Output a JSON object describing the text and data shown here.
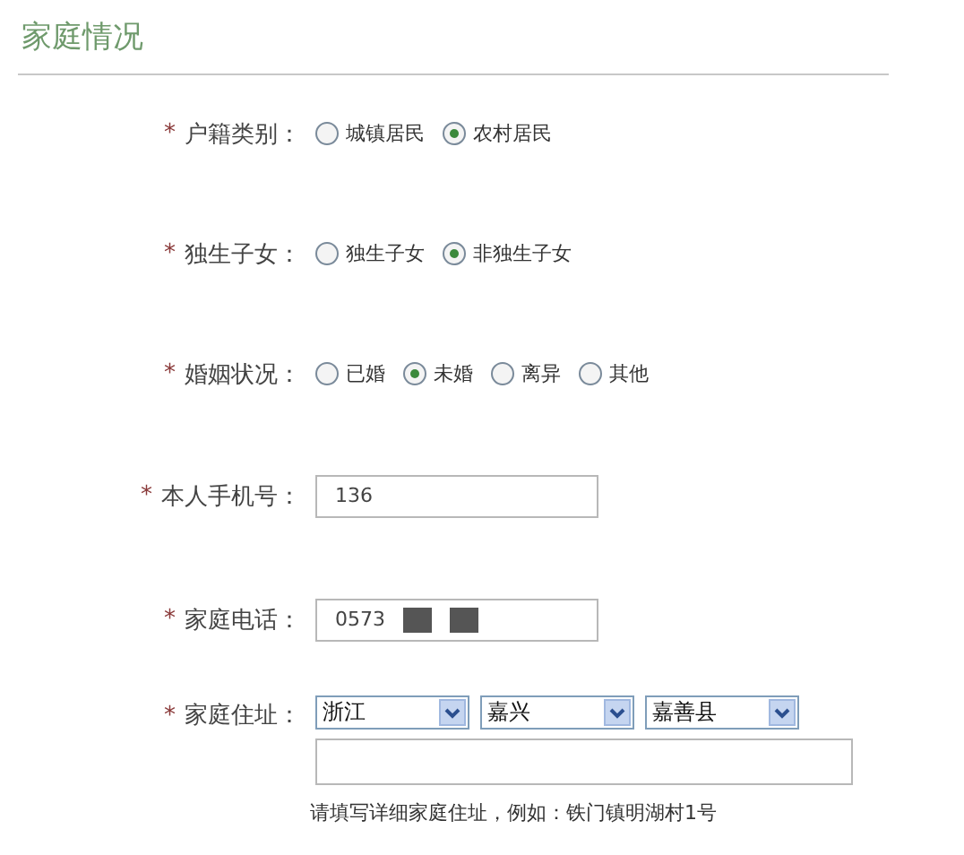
{
  "section": {
    "title": "家庭情况"
  },
  "fields": [
    {
      "kind": "radio",
      "required_mark": "*",
      "label": "户籍类别：",
      "options": [
        {
          "label": "城镇居民",
          "selected": false
        },
        {
          "label": "农村居民",
          "selected": true
        }
      ]
    },
    {
      "kind": "radio",
      "required_mark": "*",
      "label": "独生子女：",
      "options": [
        {
          "label": "独生子女",
          "selected": false
        },
        {
          "label": "非独生子女",
          "selected": true
        }
      ]
    },
    {
      "kind": "radio",
      "required_mark": "*",
      "label": "婚姻状况：",
      "options": [
        {
          "label": "已婚",
          "selected": false
        },
        {
          "label": "未婚",
          "selected": true
        },
        {
          "label": "离异",
          "selected": false
        },
        {
          "label": "其他",
          "selected": false
        }
      ]
    },
    {
      "kind": "text",
      "required_mark": "*",
      "label": "本人手机号：",
      "value": "136"
    },
    {
      "kind": "text",
      "required_mark": "*",
      "label": "家庭电话：",
      "value": "0573",
      "redacted": true
    },
    {
      "kind": "address",
      "required_mark": "*",
      "label": "家庭住址：",
      "selects": [
        {
          "value": "浙江"
        },
        {
          "value": "嘉兴"
        },
        {
          "value": "嘉善县"
        }
      ],
      "hint": "请填写详细家庭住址，例如：铁门镇明湖村1号"
    }
  ]
}
